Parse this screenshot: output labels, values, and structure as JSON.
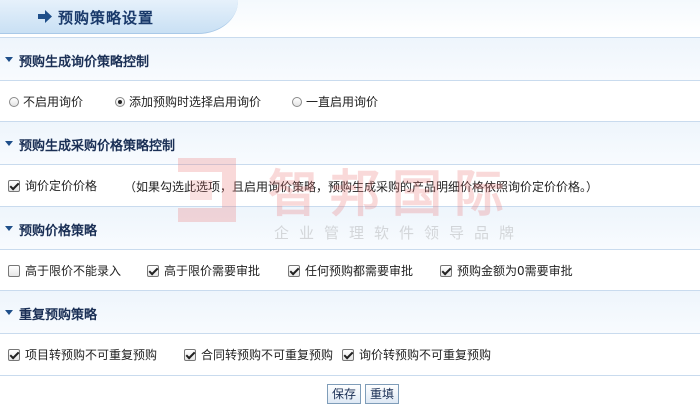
{
  "page": {
    "title": "预购策略设置"
  },
  "watermark": {
    "brand": "智邦国际",
    "slogan": "企业管理软件领导品牌"
  },
  "sections": [
    {
      "title": "预购生成询价策略控制",
      "radios": [
        {
          "label": "不启用询价",
          "checked": false
        },
        {
          "label": "添加预购时选择启用询价",
          "checked": true
        },
        {
          "label": "一直启用询价",
          "checked": false
        }
      ]
    },
    {
      "title": "预购生成采购价格策略控制",
      "checkboxes": [
        {
          "label": "询价定价价格",
          "checked": true
        }
      ],
      "note": "（如果勾选此选项，且启用询价策略，预购生成采购的产品明细价格依照询价定价价格。）"
    },
    {
      "title": "预购价格策略",
      "checkboxes": [
        {
          "label": "高于限价不能录入",
          "checked": false
        },
        {
          "label": "高于限价需要审批",
          "checked": true
        },
        {
          "label": "任何预购都需要审批",
          "checked": true
        },
        {
          "label": "预购金额为0需要审批",
          "checked": true
        }
      ]
    },
    {
      "title": "重复预购策略",
      "checkboxes": [
        {
          "label": "项目转预购不可重复预购",
          "checked": true
        },
        {
          "label": "合同转预购不可重复预购",
          "checked": true
        },
        {
          "label": "询价转预购不可重复预购",
          "checked": true
        }
      ]
    }
  ],
  "buttons": {
    "save": "保存",
    "reset": "重填"
  },
  "colors": {
    "accent": "#1f4f8a",
    "header_bg": "#eef5fc",
    "border": "#c9dbee"
  }
}
